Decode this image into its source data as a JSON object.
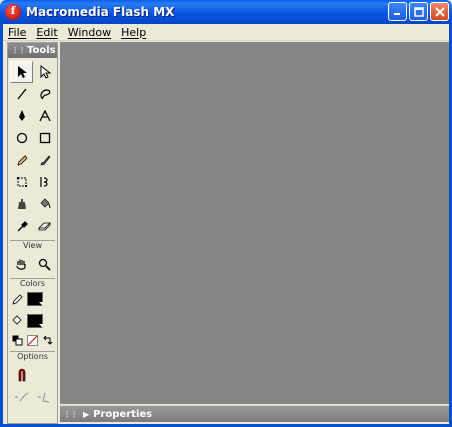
{
  "window": {
    "title": "Macromedia Flash MX"
  },
  "menu": {
    "items": [
      "File",
      "Edit",
      "Window",
      "Help"
    ]
  },
  "tools": {
    "header": "Tools",
    "view_label": "View",
    "colors_label": "Colors",
    "options_label": "Options",
    "stroke_color": "#000000",
    "fill_color": "#000000"
  },
  "properties": {
    "label": "Properties"
  }
}
